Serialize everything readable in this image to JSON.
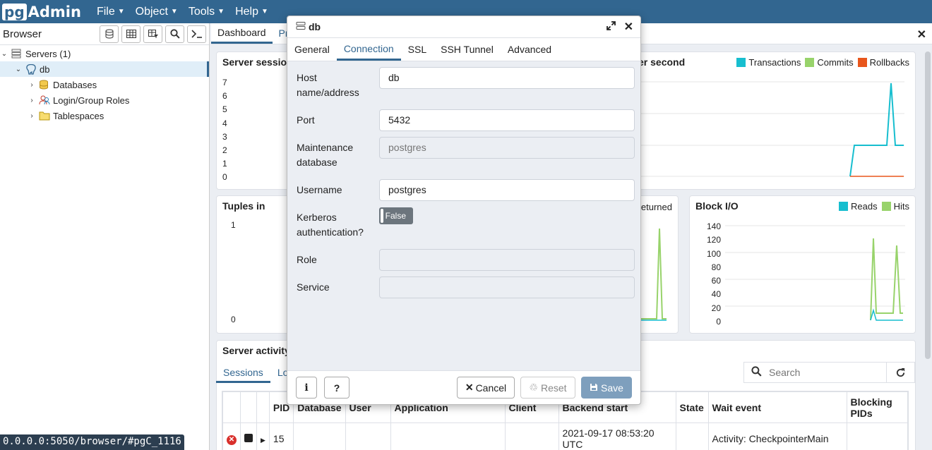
{
  "app": {
    "logo_pg": "pg",
    "logo_admin": "Admin",
    "accent": "#326690"
  },
  "menu": [
    {
      "label": "File"
    },
    {
      "label": "Object"
    },
    {
      "label": "Tools"
    },
    {
      "label": "Help"
    }
  ],
  "browser": {
    "title": "Browser",
    "toolbar": [
      "database-icon",
      "table-icon",
      "filtered-table-icon",
      "search-icon",
      "terminal-icon"
    ],
    "tree": [
      {
        "label": "Servers (1)",
        "level": 0
      },
      {
        "label": "db",
        "level": 1
      },
      {
        "label": "Databases",
        "level": 2
      },
      {
        "label": "Login/Group Roles",
        "level": 2
      },
      {
        "label": "Tablespaces",
        "level": 2
      }
    ]
  },
  "status_url": "0.0.0.0:5050/browser/#pgC_1116",
  "dashboard": {
    "tabs": [
      "Dashboard",
      "Pr"
    ],
    "server_sessions": {
      "title": "Server session",
      "ticks": [
        "7",
        "6",
        "5",
        "4",
        "3",
        "2",
        "1",
        "0"
      ]
    },
    "tps": {
      "title": "er second",
      "legend": [
        {
          "name": "Transactions",
          "color": "#17becf"
        },
        {
          "name": "Commits",
          "color": "#98d36b"
        },
        {
          "name": "Rollbacks",
          "color": "#e8561c"
        }
      ]
    },
    "tuples_in": {
      "title": "Tuples in",
      "ticks": [
        "1",
        "0"
      ]
    },
    "tuples_out": {
      "legend": "eturned"
    },
    "block_io": {
      "title": "Block I/O",
      "ticks": [
        "140",
        "120",
        "100",
        "80",
        "60",
        "40",
        "20",
        "0"
      ],
      "legend": [
        {
          "name": "Reads",
          "color": "#17becf"
        },
        {
          "name": "Hits",
          "color": "#98d36b"
        }
      ]
    },
    "server_activity": {
      "title": "Server activity",
      "tabs": [
        "Sessions",
        "Lo"
      ],
      "search_placeholder": "Search",
      "columns": [
        "",
        "",
        "",
        "PID",
        "Database",
        "User",
        "Application",
        "Client",
        "Backend start",
        "State",
        "Wait event",
        "Blocking PIDs"
      ],
      "rows": [
        {
          "pid": "15",
          "database": "",
          "user": "",
          "application": "",
          "client": "",
          "backend_start": "2021-09-17 08:53:20 UTC",
          "state": "",
          "wait_event": "Activity: CheckpointerMain",
          "blocking": ""
        }
      ]
    }
  },
  "dialog": {
    "title": "db",
    "tabs": [
      "General",
      "Connection",
      "SSL",
      "SSH Tunnel",
      "Advanced"
    ],
    "active_tab": "Connection",
    "fields": {
      "host_label": "Host name/address",
      "host_value": "db",
      "port_label": "Port",
      "port_value": "5432",
      "maint_label": "Maintenance database",
      "maint_value": "postgres",
      "user_label": "Username",
      "user_value": "postgres",
      "kerberos_label": "Kerberos authentication?",
      "kerberos_value": "False",
      "role_label": "Role",
      "role_value": "",
      "service_label": "Service",
      "service_value": ""
    },
    "footer": {
      "info": "i",
      "help": "?",
      "cancel": "Cancel",
      "reset": "Reset",
      "save": "Save"
    }
  }
}
